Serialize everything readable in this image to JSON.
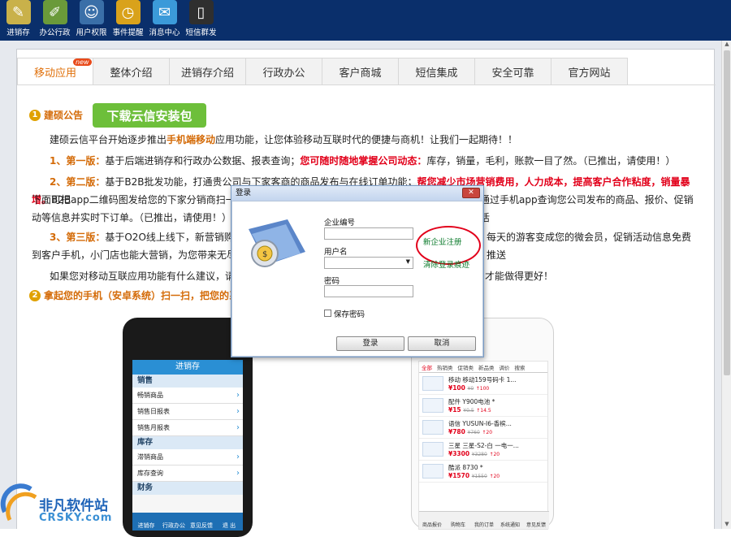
{
  "toolbar": [
    {
      "label": "进销存",
      "icon": "notebook-pencil-icon",
      "color": "#c9b14a"
    },
    {
      "label": "办公行政",
      "icon": "pencil-ruler-icon",
      "color": "#6a9a3a"
    },
    {
      "label": "用户权限",
      "icon": "user-tie-icon",
      "color": "#3a6fa8"
    },
    {
      "label": "事件提醒",
      "icon": "clock-icon",
      "color": "#d9a21b"
    },
    {
      "label": "消息中心",
      "icon": "chat-bubble-icon",
      "color": "#3b9ad9"
    },
    {
      "label": "短信群发",
      "icon": "mobile-phone-icon",
      "color": "#2f2f2f"
    }
  ],
  "tabs": [
    "移动应用",
    "整体介绍",
    "进销存介绍",
    "行政办公",
    "客户商城",
    "短信集成",
    "安全可靠",
    "官方网站"
  ],
  "new_badge": "new",
  "section1": {
    "num": "1",
    "title": "建硕公告"
  },
  "download_button": "下载云信安装包",
  "intro": {
    "pre": "建硕云信平台开始逐步推出",
    "hl": "手机端移动",
    "post": "应用功能，让您体验移动互联时代的便捷与商机！让我们一起期待！！"
  },
  "v1": {
    "tag": "1、第一版：",
    "a": "基于后端进销存和行政办公数据、报表查询；",
    "b": "您可随时随地掌握公司动态：",
    "c": "库存，销量，毛利，账款一目了然。（已推出，请使用！）"
  },
  "v2": {
    "tag": "2、第二版：",
    "a": "基于B2B批发功能，打通贵公司与下家客商的商品发布与在线订单功能；",
    "b": "帮您减少市场营销费用，人力成本，提高客户合作粘度，销量暴增。",
    "c": "可把",
    "line2a": "下面B2Bapp二维码图发给您的下家分销商扫一扫",
    "line2b": "通过手机app查询您公司发布的商品、报价、促销活",
    "line3": "动等信息并实时下订单。（已推出，请使用！）"
  },
  "v3": {
    "tag": "3、第三版：",
    "a": "基于O2O线上线下，新营销购物",
    "b": "每天的游客变成您的微会员，促销活动信息免费推送",
    "line2a": "到客户手机，小门店也能大营销，为您带来无尽商"
  },
  "closing": {
    "a": "如果您对移动互联应用功能有什么建议，请在",
    "b": "才能做得更好！"
  },
  "section2": {
    "num": "2",
    "title": "拿起您的手机（安卓系统）扫一扫，把您的系统"
  },
  "phone_left": {
    "header": "进销存",
    "sections": [
      {
        "title": "销售",
        "rows": [
          "畅销商品",
          "销售日报表",
          "销售月报表"
        ]
      },
      {
        "title": "库存",
        "rows": [
          "滞销商品",
          "库存查询"
        ]
      },
      {
        "title": "财务",
        "rows": []
      }
    ],
    "nav": [
      "进销存",
      "行政办公",
      "意见反馈",
      "退 出"
    ]
  },
  "phone_right": {
    "cats": [
      "全部",
      "热销类",
      "促销类",
      "新品类",
      "调价",
      "搜索"
    ],
    "items": [
      {
        "name": "移动 移动159号码卡 1...",
        "price": "¥100",
        "old": "¥0",
        "rec": "↑100"
      },
      {
        "name": "配件 Y900电池 *",
        "price": "¥15",
        "old": "¥0.5",
        "rec": "↑14.5"
      },
      {
        "name": "语信 YUSUN-I6-香槟...",
        "price": "¥780",
        "old": "¥760",
        "rec": "↑20"
      },
      {
        "name": "三星 三星-S2-白 一电一...",
        "price": "¥3300",
        "old": "¥3280",
        "rec": "↑20"
      },
      {
        "name": "酷派 8730 *",
        "price": "¥1570",
        "old": "¥1550",
        "rec": "↑20"
      }
    ],
    "nav": [
      "商品报价",
      "购物车",
      "我的订单",
      "系统通知",
      "意见反馈"
    ]
  },
  "dialog": {
    "title": "登录",
    "company_label": "企业编号",
    "register_link": "新企业注册",
    "username_label": "用户名",
    "clear_link": "清除登录痕迹",
    "password_label": "密码",
    "remember_label": "保存密码",
    "login_button": "登录",
    "cancel_button": "取消"
  },
  "watermark": {
    "cn": "非凡软件站",
    "en": "CRSKY.com"
  }
}
